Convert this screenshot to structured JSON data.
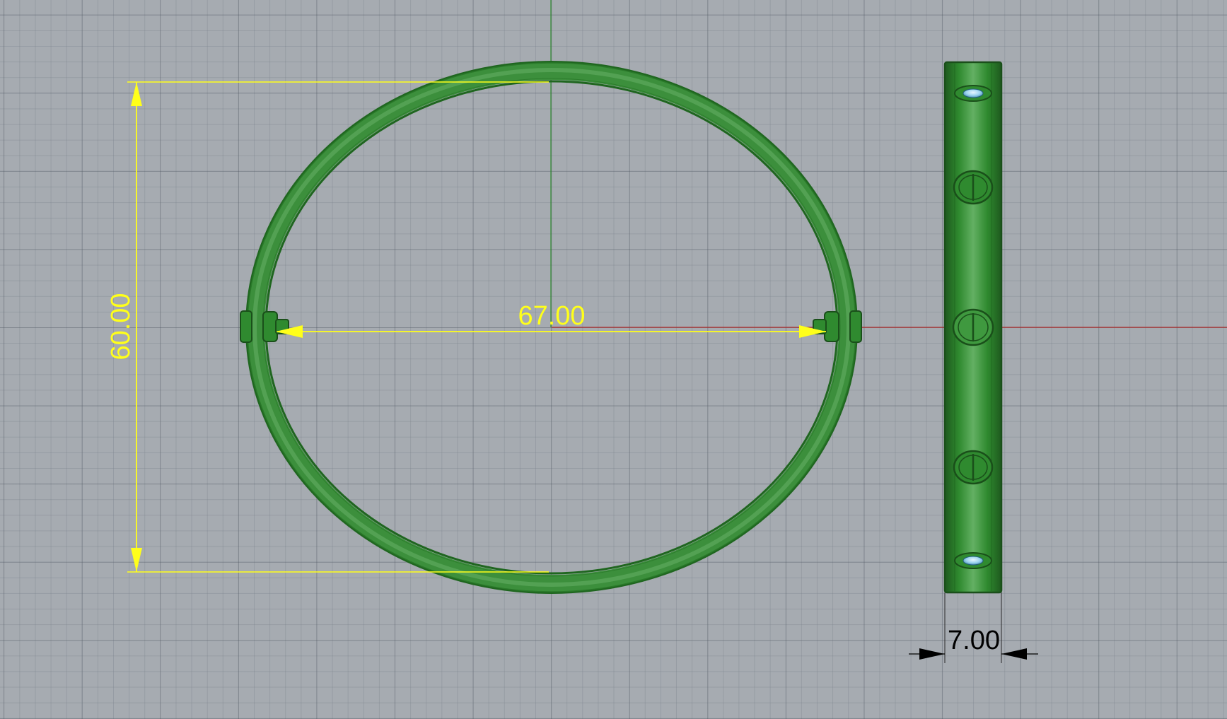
{
  "viewport": {
    "background_color": "#a6abb1",
    "grid_minor_color": "#7d8590",
    "grid_major_color": "#5e6670",
    "x_axis_color": "#b02b2b",
    "y_axis_color": "#2f8a2f"
  },
  "model": {
    "color": "#2f8a2f",
    "color_light": "#5fae5f",
    "color_dark": "#1f5f1f",
    "gem_color": "#9ad2ee"
  },
  "dimensions": {
    "width_label": "67.00",
    "height_label": "60.00",
    "thickness_label": "7.00",
    "dim_color_primary": "#ffff1a",
    "dim_color_secondary": "#000000"
  }
}
